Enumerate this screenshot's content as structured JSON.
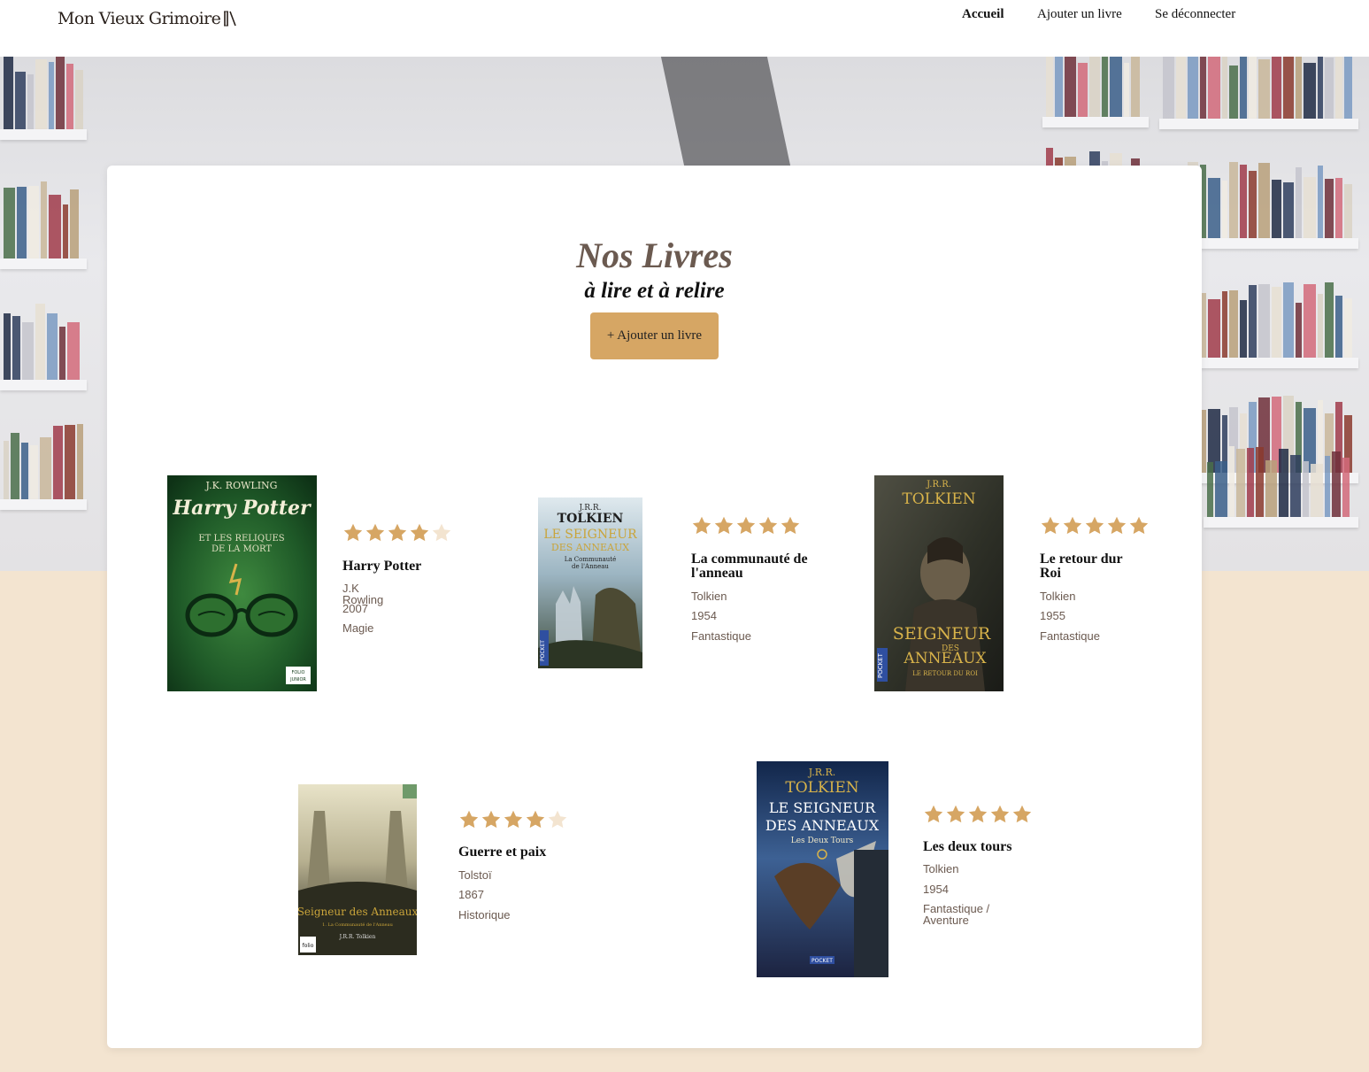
{
  "header": {
    "logo": "Mon Vieux Grimoire",
    "nav": [
      {
        "label": "Accueil",
        "active": true
      },
      {
        "label": "Ajouter un livre",
        "active": false
      },
      {
        "label": "Se déconnecter",
        "active": false
      }
    ]
  },
  "main": {
    "title": "Nos Livres",
    "subtitle": "à lire et à relire",
    "add_button": "+ Ajouter un livre"
  },
  "colors": {
    "accent": "#d6a664",
    "star_empty": "#f3e4d0",
    "meta_text": "#6b5a50",
    "page_bg": "#f3e4d0"
  },
  "books": [
    {
      "title": "Harry Potter",
      "author": "J.K Rowling",
      "year": "2007",
      "genre": "Magie",
      "rating": 4,
      "cover": {
        "top_text": "J.K. ROWLING",
        "main_text": "Harry Potter",
        "sub_text": "ET LES RELIQUES DE LA MORT",
        "badge": "FOLIO JUNIOR"
      }
    },
    {
      "title": "La communauté de l'anneau",
      "author": "Tolkien",
      "year": "1954",
      "genre": "Fantastique",
      "rating": 5,
      "cover": {
        "top_text": "J.R.R. TOLKIEN",
        "main_text": "LE SEIGNEUR DES ANNEAUX",
        "sub_text": "La Communauté de l'Anneau",
        "badge": "POCKET"
      }
    },
    {
      "title": "Le retour dur Roi",
      "author": "Tolkien",
      "year": "1955",
      "genre": "Fantastique",
      "rating": 5,
      "cover": {
        "top_text": "J.R.R. TOLKIEN",
        "main_text": "LE SEIGNEUR DES ANNEAUX",
        "sub_text": "LE RETOUR DU ROI",
        "badge": "POCKET"
      }
    },
    {
      "title": "Guerre et paix",
      "author": "Tolstoï",
      "year": "1867",
      "genre": "Historique",
      "rating": 4,
      "cover": {
        "top_text": "",
        "main_text": "Seigneur des Anneaux",
        "sub_text": "1. La Communauté de l'Anneau",
        "author_text": "J.R.R. Tolkien",
        "badge": "folio"
      }
    },
    {
      "title": "Les deux tours",
      "author": "Tolkien",
      "year": "1954",
      "genre": "Fantastique / Aventure",
      "rating": 5,
      "cover": {
        "top_text": "J.R.R. TOLKIEN",
        "main_text": "LE SEIGNEUR DES ANNEAUX",
        "sub_text": "Les Deux Tours",
        "badge": "POCKET"
      }
    }
  ]
}
